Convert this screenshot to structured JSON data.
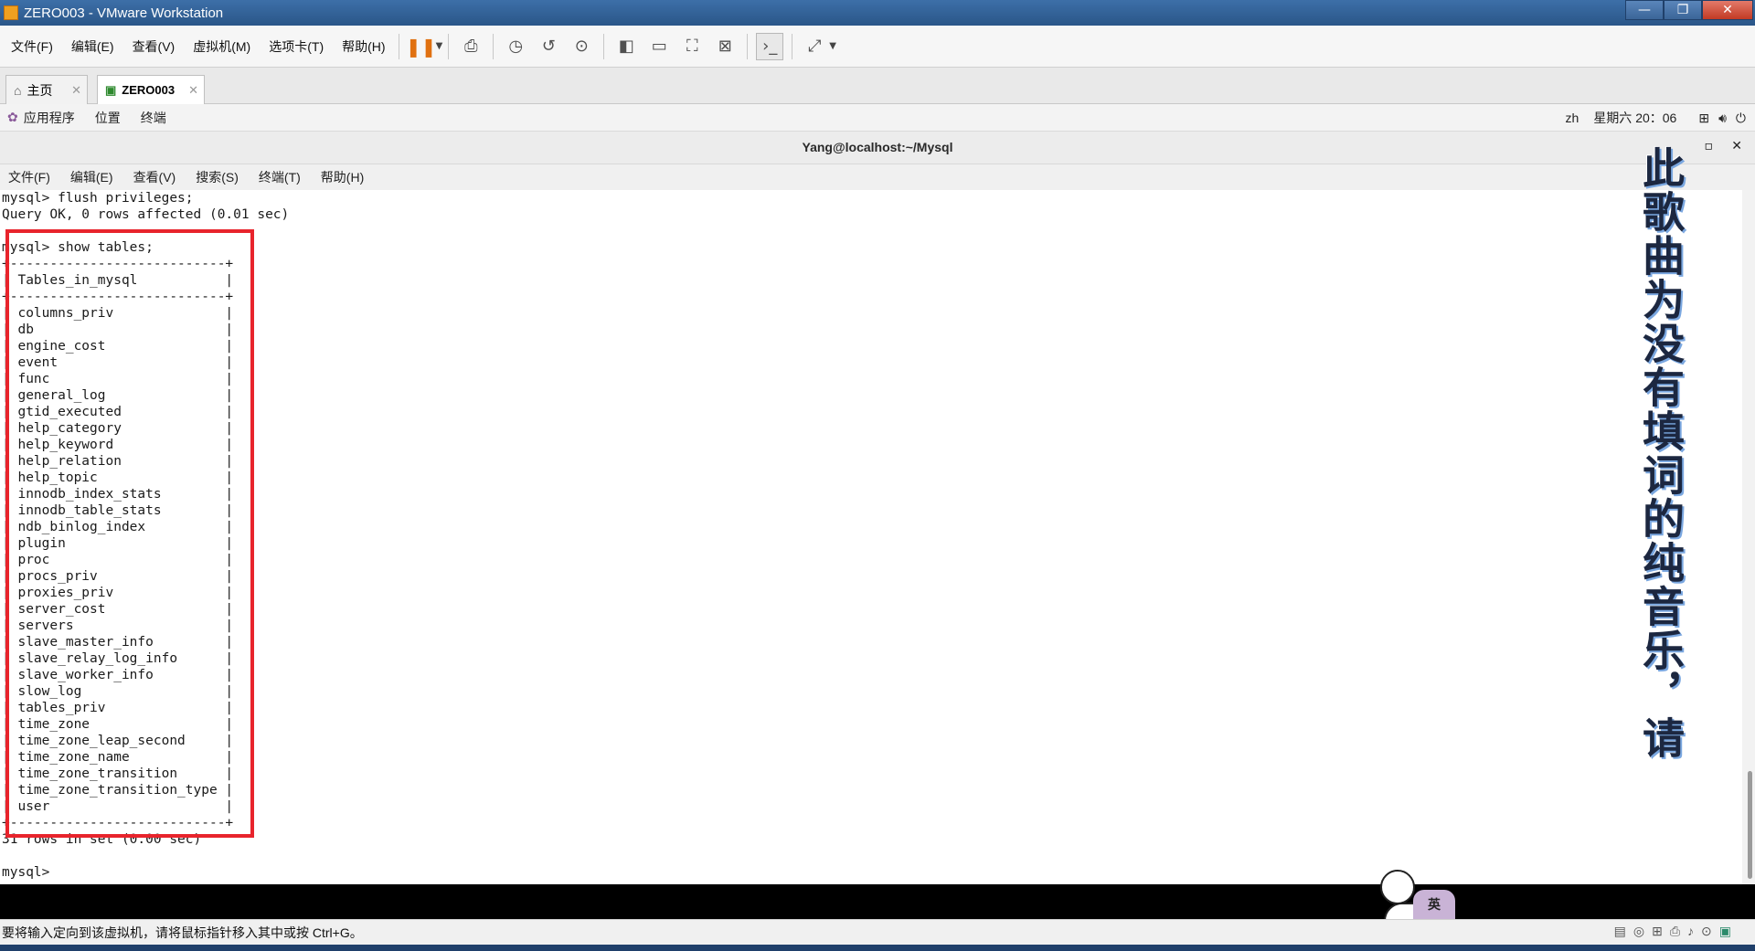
{
  "window": {
    "title": "ZERO003 - VMware Workstation",
    "minimize": "—",
    "maximize": "❐",
    "close": "✕"
  },
  "menubar": {
    "items": [
      "文件(F)",
      "编辑(E)",
      "查看(V)",
      "虚拟机(M)",
      "选项卡(T)",
      "帮助(H)"
    ]
  },
  "tabs": {
    "home": "主页",
    "vm": "ZERO003"
  },
  "guest_panel": {
    "applications": "应用程序",
    "places": "位置",
    "terminal": "终端",
    "lang": "zh",
    "datetime": "星期六 20：06"
  },
  "terminal_window": {
    "title": "Yang@localhost:~/Mysql",
    "menu": [
      "文件(F)",
      "编辑(E)",
      "查看(V)",
      "搜索(S)",
      "终端(T)",
      "帮助(H)"
    ],
    "lines": [
      "mysql> flush privileges;",
      "Query OK, 0 rows affected (0.01 sec)",
      "",
      "mysql> show tables;",
      "+---------------------------+",
      "| Tables_in_mysql           |",
      "+---------------------------+",
      "| columns_priv              |",
      "| db                        |",
      "| engine_cost               |",
      "| event                     |",
      "| func                      |",
      "| general_log               |",
      "| gtid_executed             |",
      "| help_category             |",
      "| help_keyword              |",
      "| help_relation             |",
      "| help_topic                |",
      "| innodb_index_stats        |",
      "| innodb_table_stats        |",
      "| ndb_binlog_index          |",
      "| plugin                    |",
      "| proc                      |",
      "| procs_priv                |",
      "| proxies_priv              |",
      "| server_cost               |",
      "| servers                   |",
      "| slave_master_info         |",
      "| slave_relay_log_info      |",
      "| slave_worker_info         |",
      "| slow_log                  |",
      "| tables_priv               |",
      "| time_zone                 |",
      "| time_zone_leap_second     |",
      "| time_zone_name            |",
      "| time_zone_transition      |",
      "| time_zone_transition_type |",
      "| user                      |",
      "+---------------------------+",
      "31 rows in set (0.00 sec)",
      "",
      "mysql> "
    ]
  },
  "lyrics": "此歌曲为没有填词的纯音乐，请您",
  "status": {
    "message": "要将输入定向到该虚拟机，请将鼠标指针移入其中或按 Ctrl+G。"
  },
  "mascot": {
    "badge": "英"
  },
  "colors": {
    "highlight": "#e8242c",
    "titlebar": "#2a5688",
    "pause": "#e07010"
  }
}
